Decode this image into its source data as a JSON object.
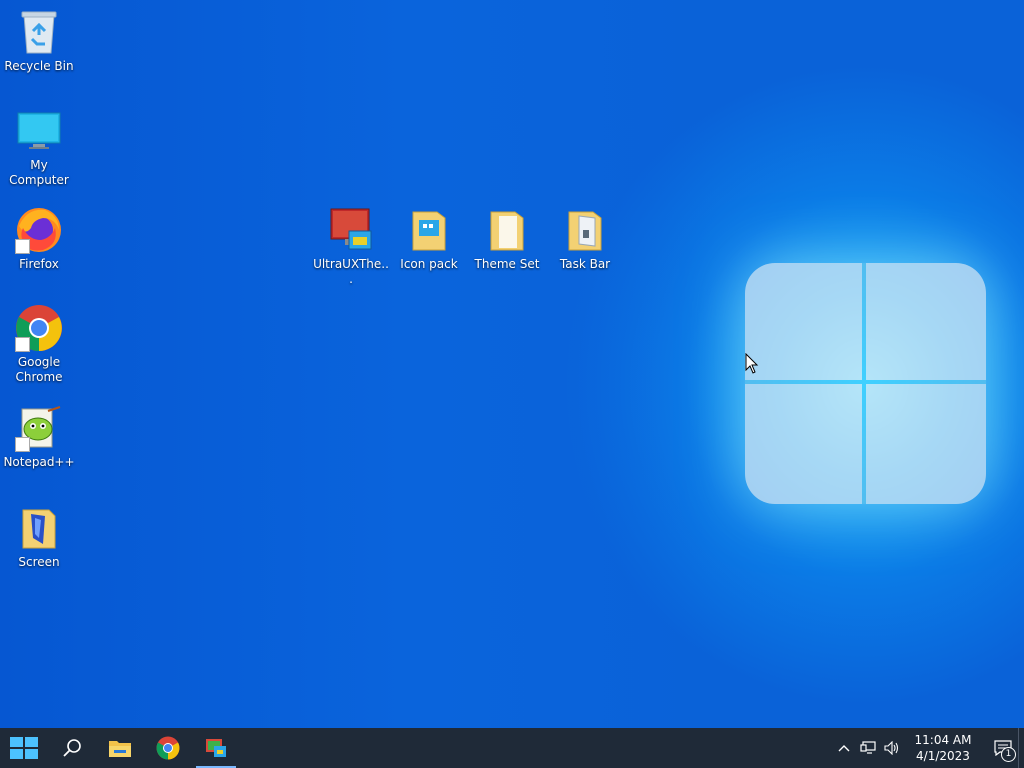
{
  "desktop": {
    "icons": [
      {
        "label": "Recycle Bin"
      },
      {
        "label": "My Computer"
      },
      {
        "label": "Firefox"
      },
      {
        "label": "Google Chrome"
      },
      {
        "label": "Notepad++"
      },
      {
        "label": "Screen"
      },
      {
        "label": "UltraUXThe..."
      },
      {
        "label": "Icon pack"
      },
      {
        "label": "Theme Set"
      },
      {
        "label": "Task Bar"
      }
    ]
  },
  "taskbar": {
    "pinned": [
      {
        "icon": "start-icon"
      },
      {
        "icon": "search-icon"
      },
      {
        "icon": "file-explorer-icon"
      },
      {
        "icon": "chrome-icon"
      },
      {
        "icon": "app-icon",
        "active": true
      }
    ],
    "tray": {
      "overflow_icon": "chevron-up-icon",
      "network_icon": "network-icon",
      "volume_icon": "volume-icon",
      "time": "11:04 AM",
      "date": "4/1/2023",
      "notification_count": "1"
    }
  },
  "colors": {
    "desktop_bg": "#0a5fd8",
    "taskbar_bg": "#1f2a38",
    "accent": "#7ab8ff"
  }
}
